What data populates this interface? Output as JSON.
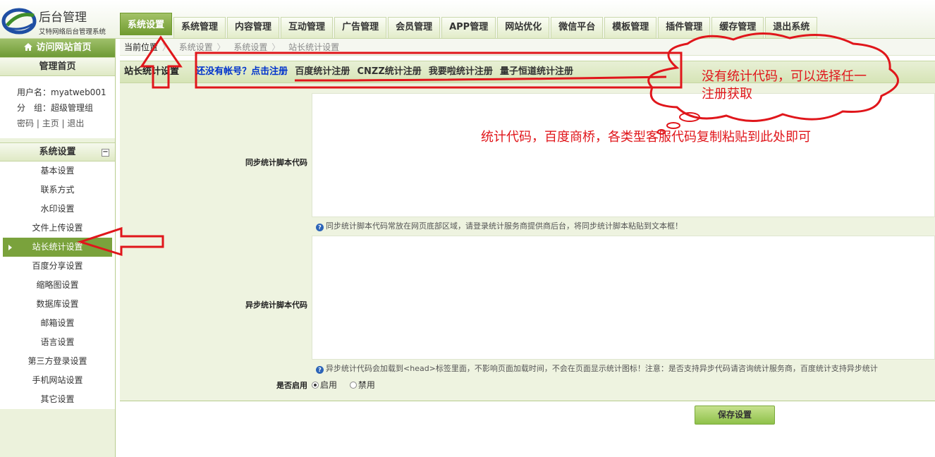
{
  "header": {
    "logo_title": "后台管理",
    "logo_subtitle": "艾特网络后台管理系统",
    "nav_tabs": [
      {
        "label": "系统设置",
        "active": true
      },
      {
        "label": "系统管理"
      },
      {
        "label": "内容管理"
      },
      {
        "label": "互动管理"
      },
      {
        "label": "广告管理"
      },
      {
        "label": "会员管理"
      },
      {
        "label": "APP管理"
      },
      {
        "label": "网站优化"
      },
      {
        "label": "微信平台"
      },
      {
        "label": "模板管理"
      },
      {
        "label": "插件管理"
      },
      {
        "label": "缓存管理"
      },
      {
        "label": "退出系统"
      }
    ]
  },
  "sidebar": {
    "visit_home": "访问网站首页",
    "manage_home": "管理首页",
    "user_label": "用户名：",
    "user_name": "myatweb001",
    "group_label": "分　组：",
    "group_name": "超级管理组",
    "link_password": "密码",
    "link_home": "主页",
    "link_logout": "退出",
    "section_title": "系统设置",
    "items": [
      {
        "label": "基本设置"
      },
      {
        "label": "联系方式"
      },
      {
        "label": "水印设置"
      },
      {
        "label": "文件上传设置"
      },
      {
        "label": "站长统计设置",
        "active": true
      },
      {
        "label": "百度分享设置"
      },
      {
        "label": "缩略图设置"
      },
      {
        "label": "数据库设置"
      },
      {
        "label": "邮箱设置"
      },
      {
        "label": "语言设置"
      },
      {
        "label": "第三方登录设置"
      },
      {
        "label": "手机网站设置"
      },
      {
        "label": "其它设置"
      }
    ]
  },
  "breadcrumb": {
    "current": "当前位置",
    "items": [
      "系统设置",
      "系统设置",
      "站长统计设置"
    ]
  },
  "titlebar": {
    "title": "站长统计设置",
    "register_prompt": "还没有帐号？点击注册",
    "links": [
      "百度统计注册",
      "CNZZ统计注册",
      "我要啦统计注册",
      "量子恒道统计注册"
    ]
  },
  "form": {
    "sync_label": "同步统计脚本代码",
    "sync_value": "",
    "sync_hint": "同步统计脚本代码常放在网页底部区域，请登录统计服务商提供商后台，将同步统计脚本粘贴到文本框！",
    "async_label": "异步统计脚本代码",
    "async_value": "",
    "async_hint": "异步统计代码会加载到<head>标签里面，不影响页面加载时间，不会在页面显示统计图标！注意：是否支持异步代码请咨询统计服务商，百度统计支持异步统计",
    "enable_label": "是否启用",
    "option_enable": "启用",
    "option_disable": "禁用",
    "enabled": true,
    "save_label": "保存设置"
  },
  "annotations": {
    "cloud_text": "没有统计代码，可以选择任一注册获取",
    "paste_text": "统计代码，百度商桥，各类型客服代码复制粘贴到此处即可",
    "color": "#e0161b"
  },
  "colors": {
    "accent": "#7aa23c",
    "register_link": "#0033cc"
  }
}
